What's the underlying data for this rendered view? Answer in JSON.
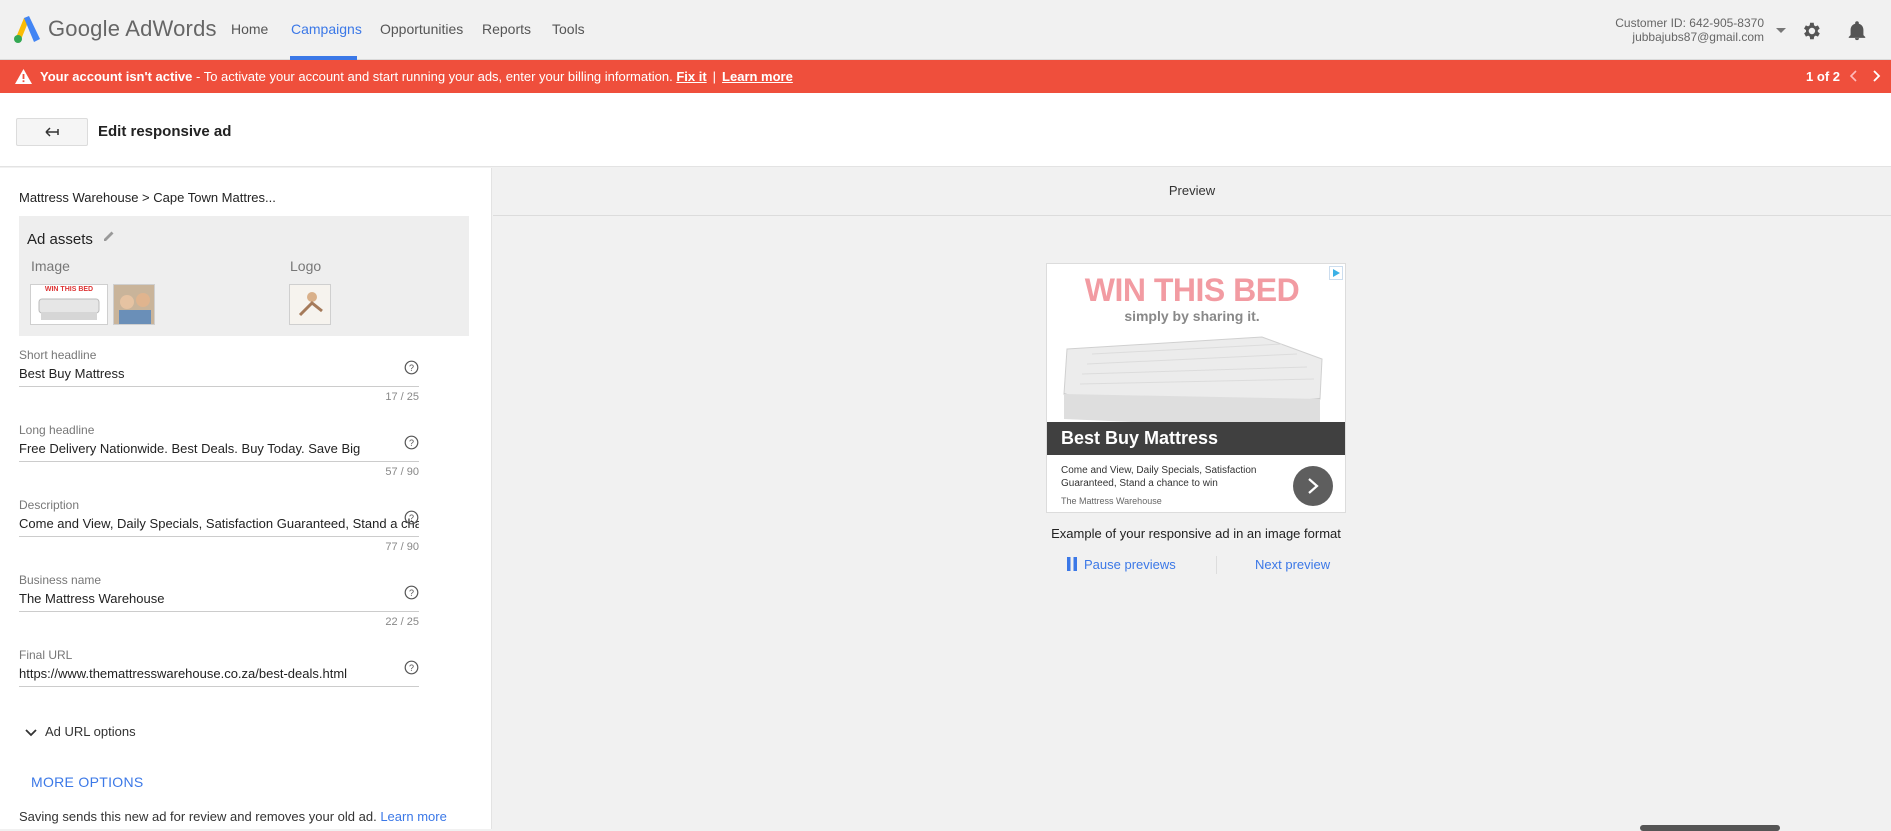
{
  "app": {
    "brand": "Google AdWords",
    "accent": "#3b78e7",
    "alert_color": "#ef4f3c"
  },
  "nav": {
    "items": [
      {
        "label": "Home"
      },
      {
        "label": "Campaigns",
        "active": true
      },
      {
        "label": "Opportunities"
      },
      {
        "label": "Reports"
      },
      {
        "label": "Tools"
      }
    ]
  },
  "account": {
    "customer_id": "Customer ID: 642-905-8370",
    "email": "jubbajubs87@gmail.com",
    "icons": [
      "caret-down-icon",
      "gear-icon",
      "bell-icon"
    ]
  },
  "alert": {
    "title": "Your account isn't active",
    "message": " - To activate your account and start running your ads, enter your billing information.",
    "fix_link": "Fix it",
    "separator": "|",
    "learn_link": "Learn more",
    "pager": "1 of 2"
  },
  "header": {
    "title": "Edit responsive ad"
  },
  "breadcrumb": "Mattress Warehouse > Cape Town Mattres...",
  "assets": {
    "title": "Ad assets",
    "image_label": "Image",
    "logo_label": "Logo",
    "thumb_text": "WIN THIS BED"
  },
  "fields": {
    "short_headline": {
      "label": "Short headline",
      "value": "Best Buy Mattress",
      "count": "17 / 25"
    },
    "long_headline": {
      "label": "Long headline",
      "value": "Free Delivery Nationwide. Best Deals. Buy Today. Save Big",
      "count": "57 / 90"
    },
    "description": {
      "label": "Description",
      "value": "Come and View, Daily Specials, Satisfaction Guaranteed, Stand a chance to win",
      "count": "77 / 90"
    },
    "business_name": {
      "label": "Business name",
      "value": "The Mattress Warehouse",
      "count": "22 / 25"
    },
    "final_url": {
      "label": "Final URL",
      "value": "https://www.themattresswarehouse.co.za/best-deals.html"
    }
  },
  "url_options": "Ad URL options",
  "more_options": "MORE OPTIONS",
  "saving": {
    "text": "Saving sends this new ad for review and removes your old ad.",
    "link": "Learn more"
  },
  "preview": {
    "heading": "Preview",
    "image_title": "WIN THIS BED",
    "image_subtitle": "simply by sharing it.",
    "headline": "Best Buy Mattress",
    "description": "Come and View, Daily Specials, Satisfaction Guaranteed, Stand a chance to win",
    "business": "The Mattress Warehouse",
    "caption": "Example of your responsive ad in an image format",
    "pause_label": "Pause previews",
    "next_label": "Next preview"
  }
}
